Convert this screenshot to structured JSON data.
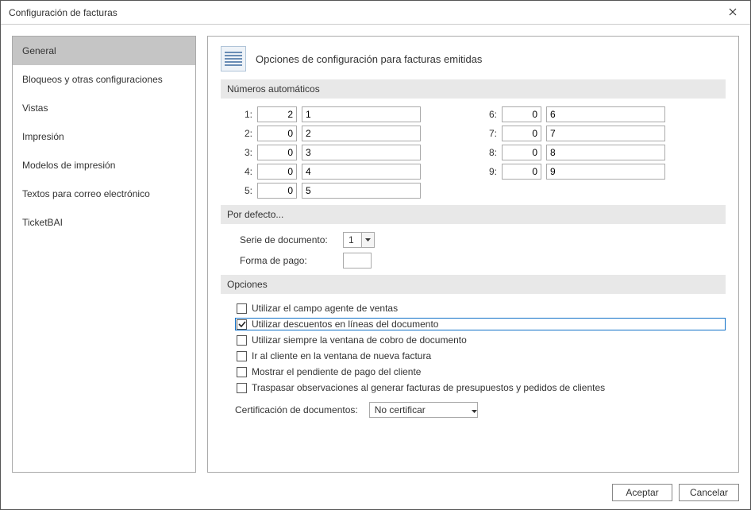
{
  "window": {
    "title": "Configuración de facturas"
  },
  "sidebar": {
    "items": [
      {
        "label": "General",
        "selected": true
      },
      {
        "label": "Bloqueos y otras configuraciones",
        "selected": false
      },
      {
        "label": "Vistas",
        "selected": false
      },
      {
        "label": "Impresión",
        "selected": false
      },
      {
        "label": "Modelos de impresión",
        "selected": false
      },
      {
        "label": "Textos para correo electrónico",
        "selected": false
      },
      {
        "label": "TicketBAI",
        "selected": false
      }
    ]
  },
  "main": {
    "header_title": "Opciones de configuración para facturas emitidas",
    "sections": {
      "auto_numbers": {
        "title": "Números automáticos",
        "rows": [
          {
            "label": "1:",
            "a": "2",
            "b": "1"
          },
          {
            "label": "2:",
            "a": "0",
            "b": "2"
          },
          {
            "label": "3:",
            "a": "0",
            "b": "3"
          },
          {
            "label": "4:",
            "a": "0",
            "b": "4"
          },
          {
            "label": "5:",
            "a": "0",
            "b": "5"
          },
          {
            "label": "6:",
            "a": "0",
            "b": "6"
          },
          {
            "label": "7:",
            "a": "0",
            "b": "7"
          },
          {
            "label": "8:",
            "a": "0",
            "b": "8"
          },
          {
            "label": "9:",
            "a": "0",
            "b": "9"
          }
        ]
      },
      "defaults": {
        "title": "Por defecto...",
        "serie_label": "Serie de documento:",
        "serie_value": "1",
        "forma_label": "Forma de pago:",
        "forma_value": ""
      },
      "options": {
        "title": "Opciones",
        "checks": [
          {
            "label": "Utilizar el campo agente de ventas",
            "checked": false,
            "highlighted": false
          },
          {
            "label": "Utilizar descuentos en líneas del documento",
            "checked": true,
            "highlighted": true
          },
          {
            "label": "Utilizar siempre la ventana de cobro de documento",
            "checked": false,
            "highlighted": false
          },
          {
            "label": "Ir al cliente en la ventana de nueva factura",
            "checked": false,
            "highlighted": false
          },
          {
            "label": "Mostrar el pendiente de pago del cliente",
            "checked": false,
            "highlighted": false
          },
          {
            "label": "Traspasar observaciones al generar facturas de presupuestos y pedidos de clientes",
            "checked": false,
            "highlighted": false
          }
        ],
        "cert_label": "Certificación de documentos:",
        "cert_value": "No certificar"
      }
    }
  },
  "footer": {
    "ok": "Aceptar",
    "cancel": "Cancelar"
  }
}
